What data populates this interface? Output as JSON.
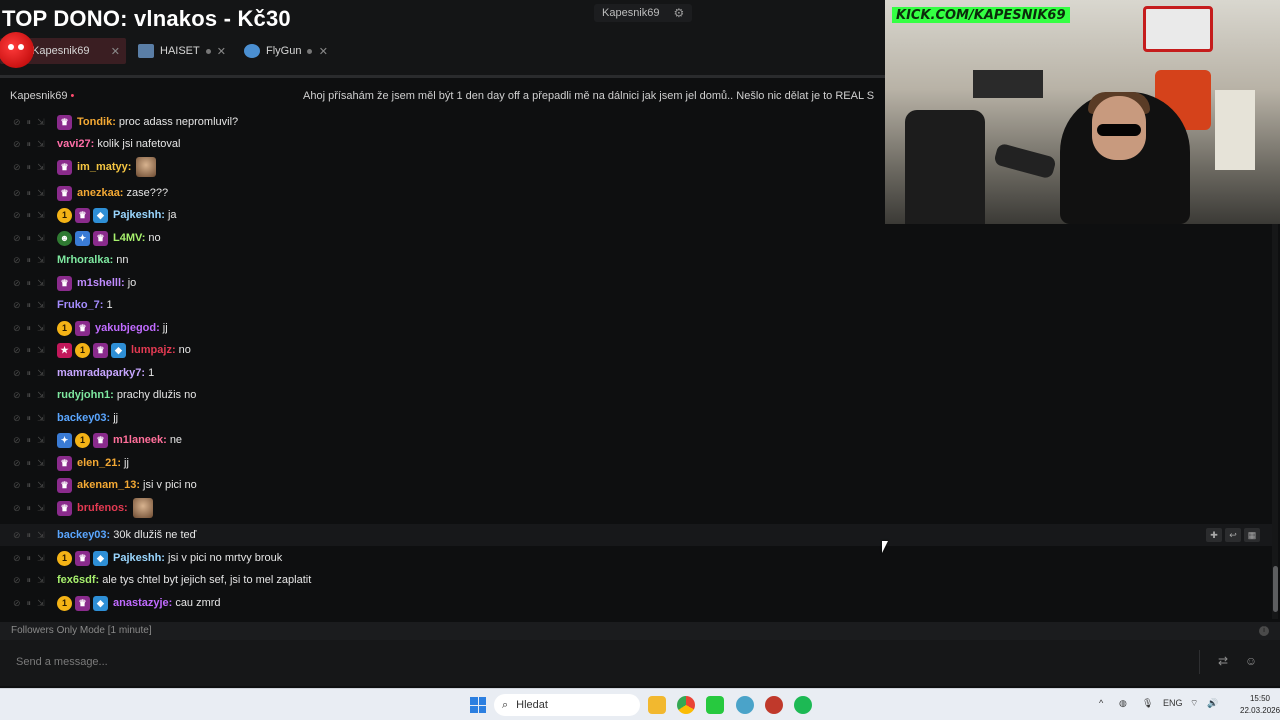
{
  "overlay": {
    "donation_title": "TOP DONO: vlnakos - Kč30"
  },
  "top_channel": {
    "label": "Kapesnik69"
  },
  "tabs": [
    {
      "label": "Kapesnik69",
      "active": true
    },
    {
      "label": "HAISET",
      "active": false
    },
    {
      "label": "FlyGun",
      "active": false
    }
  ],
  "channel_header": {
    "name": "Kapesnik69",
    "stream_title": "Ahoj přísahám že jsem měl být 1 den day off a přepadli mě na dálnici jak jsem jel domů.. Nešlo nic dělat je to REAL S"
  },
  "webcam": {
    "banner": "KICK.COM/KAPESNIK69"
  },
  "messages": [
    {
      "user": "Tondik",
      "color": "#f4a934",
      "badges": [
        "sub"
      ],
      "text": "proc adass nepromluvil?",
      "emote": false
    },
    {
      "user": "vavi27",
      "color": "#ff6fa8",
      "badges": [],
      "text": "kolik jsi nafetoval",
      "emote": false
    },
    {
      "user": "im_matyy",
      "color": "#f4c542",
      "badges": [
        "sub"
      ],
      "text": "",
      "emote": true
    },
    {
      "user": "anezkaa",
      "color": "#f4a934",
      "badges": [
        "sub"
      ],
      "text": "zase???",
      "emote": false
    },
    {
      "user": "Pajkeshh",
      "color": "#9ad7ff",
      "badges": [
        "one",
        "sub",
        "gift"
      ],
      "text": "ja",
      "emote": false
    },
    {
      "user": "L4MV",
      "color": "#a7f06d",
      "badges": [
        "frog",
        "vip",
        "sub"
      ],
      "text": "no",
      "emote": false
    },
    {
      "user": "Mrhoralka",
      "color": "#7ee8a0",
      "badges": [],
      "text": "nn",
      "emote": false
    },
    {
      "user": "m1shelll",
      "color": "#c08cff",
      "badges": [
        "sub"
      ],
      "text": "jo",
      "emote": false
    },
    {
      "user": "Fruko_7",
      "color": "#a58cff",
      "badges": [],
      "text": "1",
      "emote": false
    },
    {
      "user": "yakubjegod",
      "color": "#c06bff",
      "badges": [
        "one",
        "sub"
      ],
      "text": "jj",
      "emote": false
    },
    {
      "user": "lumpajz",
      "color": "#e23a52",
      "badges": [
        "pink",
        "one",
        "sub",
        "gift"
      ],
      "text": "no",
      "emote": false
    },
    {
      "user": "mamradaparky7",
      "color": "#c7a6ff",
      "badges": [],
      "text": "1",
      "emote": false
    },
    {
      "user": "rudyjohn1",
      "color": "#7ee8a0",
      "badges": [],
      "text": "prachy dlužis no",
      "emote": false
    },
    {
      "user": "backey03",
      "color": "#5aa6ff",
      "badges": [],
      "text": "jj",
      "emote": false
    },
    {
      "user": "m1laneek",
      "color": "#ff6f9a",
      "badges": [
        "vip",
        "one",
        "sub"
      ],
      "text": "ne",
      "emote": false
    },
    {
      "user": "elen_21",
      "color": "#f4a934",
      "badges": [
        "sub"
      ],
      "text": "jj",
      "emote": false
    },
    {
      "user": "akenam_13",
      "color": "#f4a934",
      "badges": [
        "sub"
      ],
      "text": "jsi v pici no",
      "emote": false
    },
    {
      "user": "brufenos",
      "color": "#e23a52",
      "badges": [
        "sub"
      ],
      "text": "",
      "emote": true
    },
    {
      "user": "backey03",
      "color": "#5aa6ff",
      "badges": [],
      "text": "30k dlužiš ne teď",
      "emote": false
    },
    {
      "user": "Pajkeshh",
      "color": "#9ad7ff",
      "badges": [
        "one",
        "sub",
        "gift"
      ],
      "text": "jsi v pici no mrtvy brouk",
      "emote": false
    },
    {
      "user": "fex6sdf",
      "color": "#a7f06d",
      "badges": [],
      "text": "ale tys chtel byt jejich sef, jsi to mel zaplatit",
      "emote": false
    },
    {
      "user": "anastazyje",
      "color": "#c06bff",
      "badges": [
        "one",
        "sub",
        "gift"
      ],
      "text": "cau zmrd",
      "emote": false
    }
  ],
  "chat_mode": {
    "label": "Followers Only Mode [1 minute]"
  },
  "message_input": {
    "placeholder": "Send a message..."
  },
  "taskbar": {
    "search_placeholder": "Hledat",
    "language": "ENG",
    "time": "15:50",
    "date": "22.03.2026"
  }
}
